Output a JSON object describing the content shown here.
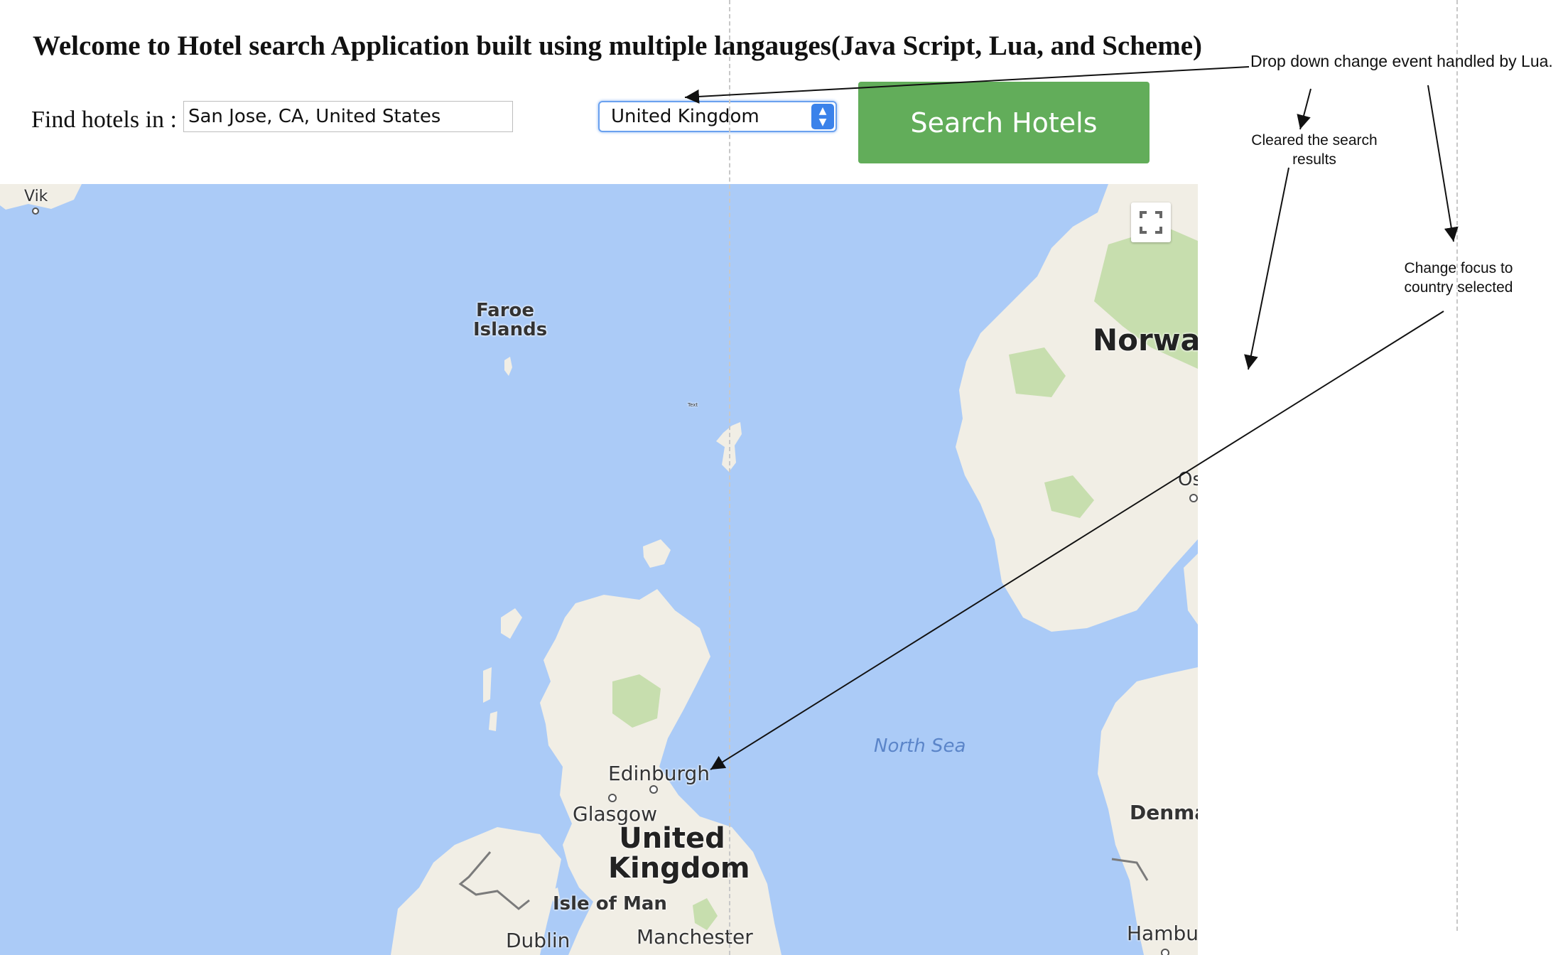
{
  "header": {
    "title": "Welcome to Hotel search Application built using multiple langauges(Java Script, Lua, and Scheme)"
  },
  "search": {
    "find_label": "Find hotels in :",
    "location_value": "San Jose, CA, United States",
    "country_selected": "United Kingdom",
    "button_label": "Search Hotels"
  },
  "map": {
    "labels": {
      "vik": "Vik",
      "faroe": "Faroe Islands",
      "text_marker": "Text",
      "norway": "Norway",
      "oslo": "Os",
      "north_sea": "North Sea",
      "edinburgh": "Edinburgh",
      "glasgow": "Glasgow",
      "united_kingdom": "United Kingdom",
      "isle_of_man": "Isle of Man",
      "dublin": "Dublin",
      "manchester": "Manchester",
      "denmark": "Denmai",
      "hamburg": "Hambur"
    },
    "colors": {
      "water": "#abcbf7",
      "land": "#f1eee5",
      "forest": "#c7deae"
    }
  },
  "annotations": {
    "dropdown_event": "Drop down change event handled by Lua.",
    "cleared_results": "Cleared the search results",
    "change_focus": "Change focus to country selected"
  },
  "colors": {
    "button": "#62ad5a",
    "select_border": "#6aa1ef"
  }
}
